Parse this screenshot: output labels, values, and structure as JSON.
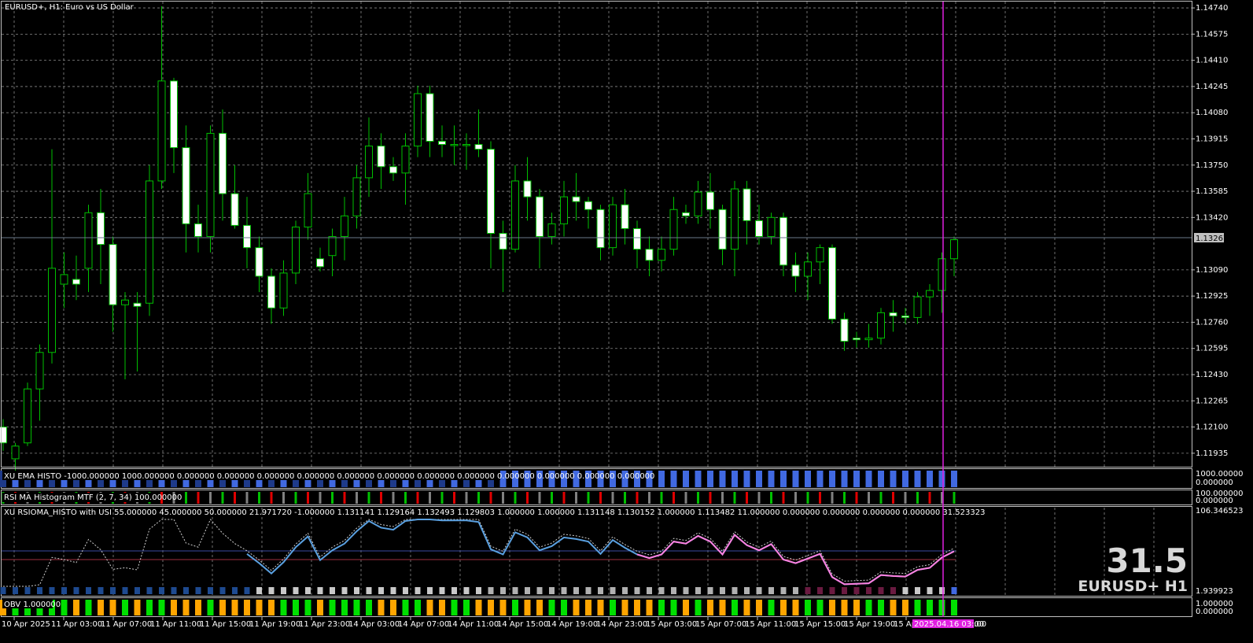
{
  "colors": {
    "background": "#000000",
    "grid": "#8a8a8a",
    "frame": "#c0c0c0",
    "candle_wick": "#00c000",
    "candle_bull": "#000000",
    "candle_bear": "#ffffff",
    "vline": "#e020e0",
    "ema_blue": "#4169e1",
    "ema_dark": "#1e3a8a",
    "rsi_green": "#00c000",
    "rsi_red": "#e00000",
    "rsi_gray": "#808080",
    "rsioma_line": "#5aa0e0",
    "rsioma_pink": "#ff80e0",
    "obv_green": "#00e000",
    "obv_orange": "#ffa500",
    "watermark": "#d8d8d8"
  },
  "main_chart": {
    "title": "EURUSD+, H1:  Euro vs US Dollar",
    "y_labels": [
      "1.14740",
      "1.14575",
      "1.14410",
      "1.14245",
      "1.14080",
      "1.13915",
      "1.13750",
      "1.13585",
      "1.13420",
      "1.13090",
      "1.12925",
      "1.12760",
      "1.12595",
      "1.12430",
      "1.12265",
      "1.12100",
      "1.11935"
    ],
    "current_price": "1.13267"
  },
  "chart_data": {
    "type": "candlestick",
    "symbol": "EURUSD+",
    "timeframe": "H1",
    "ylim": [
      1.1185,
      1.1478
    ],
    "x_labels": [
      "10 Apr 2025",
      "11 Apr 03:00",
      "11 Apr 07:00",
      "11 Apr 11:00",
      "11 Apr 15:00",
      "11 Apr 19:00",
      "11 Apr 23:00",
      "14 Apr 03:00",
      "14 Apr 07:00",
      "14 Apr 11:00",
      "14 Apr 15:00",
      "14 Apr 19:00",
      "14 Apr 23:00",
      "15 Apr 03:00",
      "15 Apr 07:00",
      "15 Apr 11:00",
      "15 Apr 15:00",
      "15 Apr 19:00",
      "15 Apr"
    ],
    "candles": [
      [
        1.121,
        1.1215,
        1.1195,
        1.12
      ],
      [
        1.119,
        1.12,
        1.118,
        1.1198
      ],
      [
        1.12,
        1.1238,
        1.1198,
        1.1234
      ],
      [
        1.1234,
        1.1262,
        1.1214,
        1.1257
      ],
      [
        1.1257,
        1.1385,
        1.125,
        1.131
      ],
      [
        1.13,
        1.132,
        1.1285,
        1.1306
      ],
      [
        1.1303,
        1.1318,
        1.129,
        1.13
      ],
      [
        1.131,
        1.135,
        1.1295,
        1.1345
      ],
      [
        1.1345,
        1.136,
        1.13,
        1.1325
      ],
      [
        1.1325,
        1.133,
        1.127,
        1.1287
      ],
      [
        1.1287,
        1.1295,
        1.124,
        1.129
      ],
      [
        1.1288,
        1.1295,
        1.1245,
        1.1286
      ],
      [
        1.1288,
        1.1375,
        1.128,
        1.1365
      ],
      [
        1.1365,
        1.1475,
        1.136,
        1.1428
      ],
      [
        1.1428,
        1.143,
        1.137,
        1.1386
      ],
      [
        1.1386,
        1.14,
        1.132,
        1.1338
      ],
      [
        1.1338,
        1.135,
        1.132,
        1.133
      ],
      [
        1.133,
        1.14,
        1.132,
        1.1395
      ],
      [
        1.1395,
        1.141,
        1.134,
        1.1357
      ],
      [
        1.1357,
        1.1375,
        1.1335,
        1.1337
      ],
      [
        1.1337,
        1.1355,
        1.131,
        1.1323
      ],
      [
        1.1323,
        1.133,
        1.1295,
        1.1305
      ],
      [
        1.1305,
        1.131,
        1.1275,
        1.1285
      ],
      [
        1.1285,
        1.1315,
        1.128,
        1.1307
      ],
      [
        1.1307,
        1.134,
        1.13,
        1.1336
      ],
      [
        1.1336,
        1.137,
        1.1328,
        1.1357
      ],
      [
        1.1316,
        1.1323,
        1.1308,
        1.1311
      ],
      [
        1.1318,
        1.1335,
        1.1305,
        1.133
      ],
      [
        1.133,
        1.1355,
        1.1315,
        1.1343
      ],
      [
        1.1343,
        1.1375,
        1.1335,
        1.1367
      ],
      [
        1.1367,
        1.1405,
        1.1355,
        1.1387
      ],
      [
        1.1387,
        1.1395,
        1.136,
        1.1374
      ],
      [
        1.1374,
        1.138,
        1.1365,
        1.137
      ],
      [
        1.137,
        1.1395,
        1.135,
        1.1387
      ],
      [
        1.1387,
        1.1425,
        1.138,
        1.142
      ],
      [
        1.142,
        1.1425,
        1.138,
        1.139
      ],
      [
        1.139,
        1.14,
        1.138,
        1.1388
      ],
      [
        1.1388,
        1.14,
        1.1375,
        1.1388
      ],
      [
        1.1388,
        1.1395,
        1.1372,
        1.1388
      ],
      [
        1.1388,
        1.141,
        1.138,
        1.1385
      ],
      [
        1.1385,
        1.139,
        1.131,
        1.1332
      ],
      [
        1.1332,
        1.134,
        1.1295,
        1.1322
      ],
      [
        1.1322,
        1.1375,
        1.132,
        1.1365
      ],
      [
        1.1365,
        1.138,
        1.134,
        1.1355
      ],
      [
        1.1355,
        1.136,
        1.131,
        1.133
      ],
      [
        1.133,
        1.1345,
        1.1325,
        1.1338
      ],
      [
        1.1338,
        1.1365,
        1.133,
        1.1355
      ],
      [
        1.1355,
        1.137,
        1.134,
        1.1352
      ],
      [
        1.1352,
        1.1355,
        1.1335,
        1.1347
      ],
      [
        1.1347,
        1.135,
        1.1315,
        1.1323
      ],
      [
        1.1323,
        1.1355,
        1.1318,
        1.135
      ],
      [
        1.135,
        1.136,
        1.1325,
        1.1335
      ],
      [
        1.1335,
        1.134,
        1.131,
        1.1322
      ],
      [
        1.1322,
        1.133,
        1.1305,
        1.1315
      ],
      [
        1.1315,
        1.133,
        1.1308,
        1.1322
      ],
      [
        1.1322,
        1.1355,
        1.1318,
        1.1347
      ],
      [
        1.1345,
        1.135,
        1.1338,
        1.1343
      ],
      [
        1.1343,
        1.1365,
        1.1338,
        1.1358
      ],
      [
        1.1358,
        1.137,
        1.1335,
        1.1347
      ],
      [
        1.1347,
        1.135,
        1.1312,
        1.1322
      ],
      [
        1.1322,
        1.1365,
        1.1305,
        1.136
      ],
      [
        1.136,
        1.1365,
        1.1325,
        1.134
      ],
      [
        1.134,
        1.135,
        1.1325,
        1.133
      ],
      [
        1.133,
        1.1345,
        1.1325,
        1.1342
      ],
      [
        1.1342,
        1.1345,
        1.1305,
        1.1312
      ],
      [
        1.1312,
        1.132,
        1.1295,
        1.1305
      ],
      [
        1.1305,
        1.132,
        1.129,
        1.1314
      ],
      [
        1.1314,
        1.1325,
        1.13,
        1.1323
      ],
      [
        1.1323,
        1.1325,
        1.1275,
        1.1278
      ],
      [
        1.1278,
        1.1282,
        1.1258,
        1.1264
      ],
      [
        1.1266,
        1.127,
        1.126,
        1.1265
      ],
      [
        1.1265,
        1.1275,
        1.126,
        1.1266
      ],
      [
        1.1266,
        1.1285,
        1.1262,
        1.1282
      ],
      [
        1.1282,
        1.129,
        1.127,
        1.128
      ],
      [
        1.128,
        1.1285,
        1.1275,
        1.1279
      ],
      [
        1.1279,
        1.1295,
        1.1275,
        1.1292
      ],
      [
        1.1292,
        1.13,
        1.128,
        1.1296
      ],
      [
        1.1296,
        1.132,
        1.1282,
        1.1316
      ],
      [
        1.1316,
        1.133,
        1.1305,
        1.1328
      ]
    ]
  },
  "indicators": {
    "ema": {
      "label": "XU EMA HISTO -1000.000000 1000.000000 0.000000 0.000000 0.000000 0.000000 0.000000 0.000000 0.000000 0.000000 0.000000 0.000000 0.000000 0.000000",
      "scale_top": "1000.00000",
      "scale_bottom": "0.000000"
    },
    "rsi": {
      "label": "RSI MA Histogram MTF (2, 7, 34) 100.000000",
      "scale_top": "100.000000",
      "scale_bottom": "0.000000"
    },
    "rsioma": {
      "label": "XU RSIOMA_HISTO with USI 55.000000 45.000000 50.000000 21.971720 -1.000000 1.131141 1.129164 1.132493 1.129803 1.000000 1.000000 1.131148 1.130152 1.000000 1.113482 11.000000 0.000000 0.000000 0.000000 0.000000 31.523323",
      "scale_top": "106.346523",
      "scale_bottom": "1.939923",
      "value": "31.5",
      "caption": "EURUSD+ H1"
    },
    "obv": {
      "label": "OBV 1.000000",
      "scale_top": "1.000000",
      "scale_bottom": "0.000000"
    }
  },
  "time_marker": "2025.04.16 03:00"
}
